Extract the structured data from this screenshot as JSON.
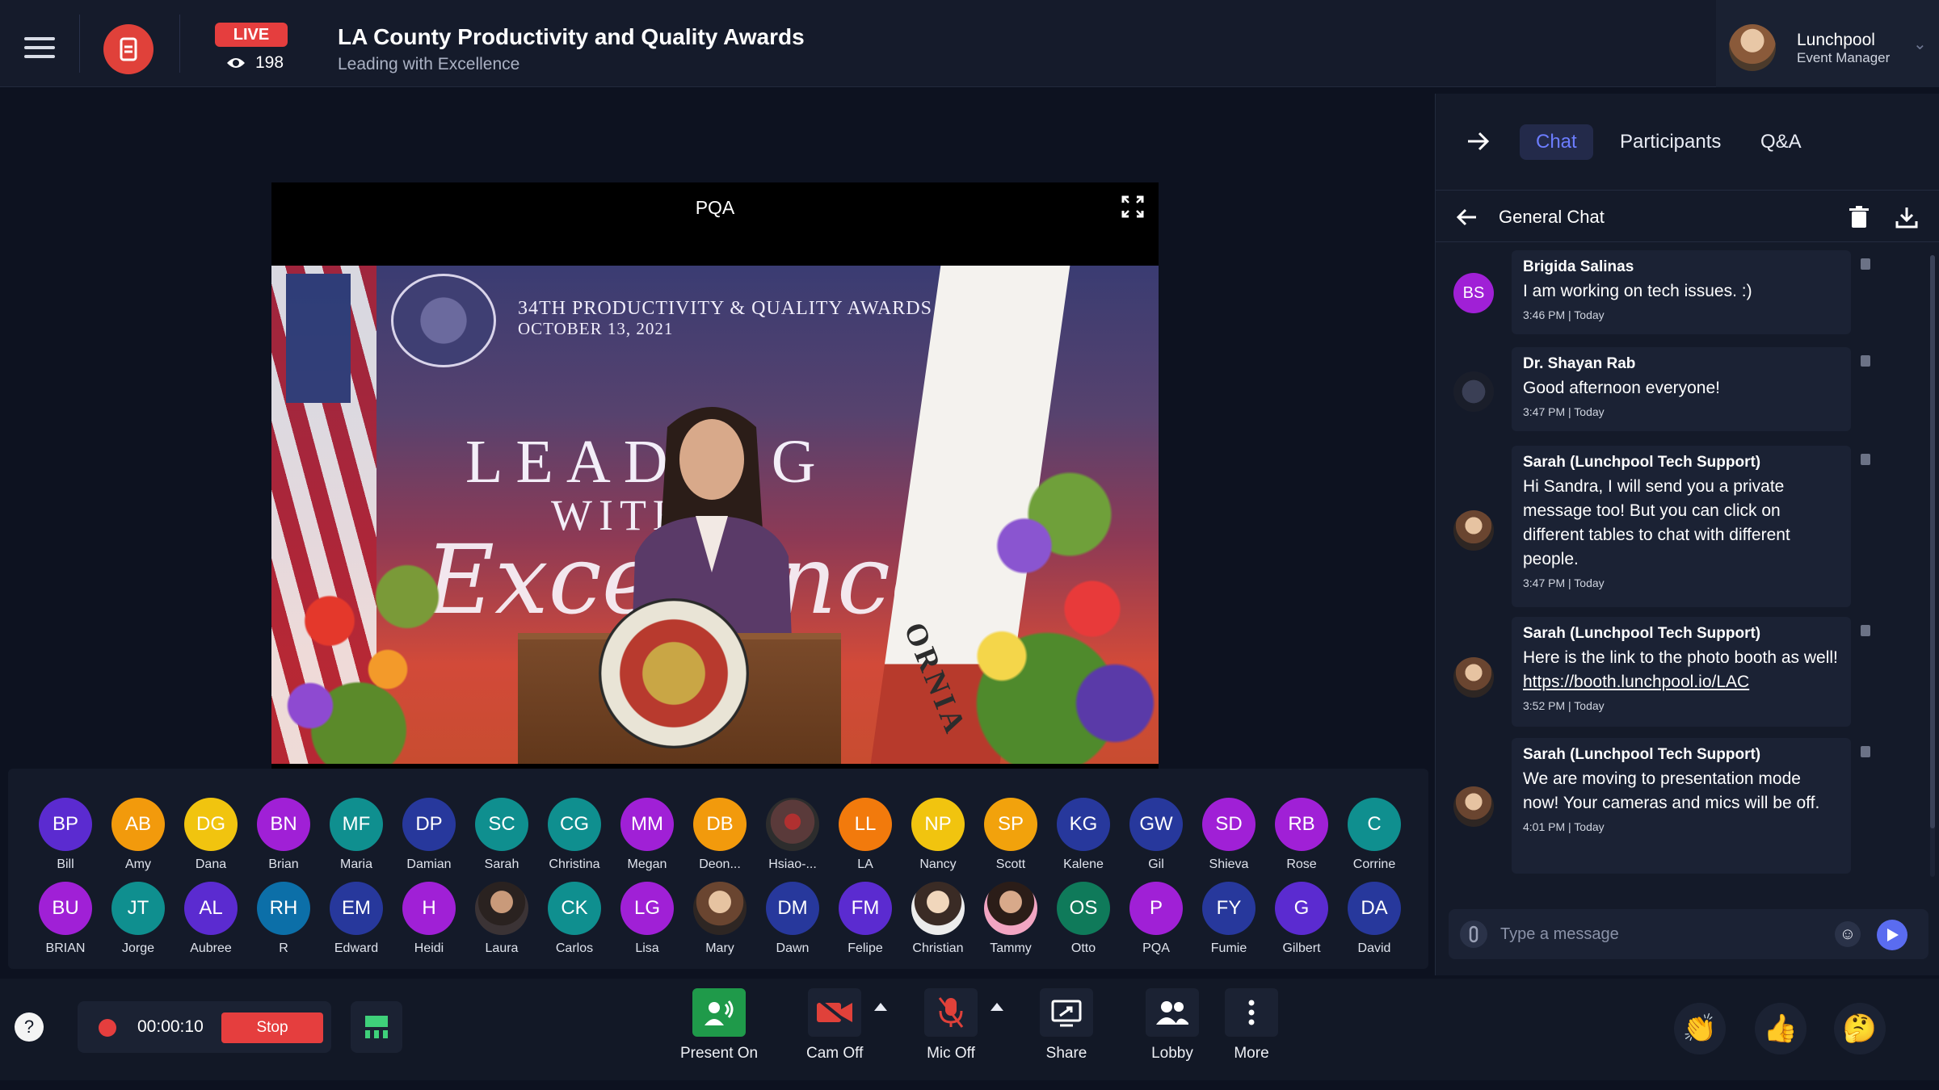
{
  "header": {
    "live_label": "LIVE",
    "viewer_count": "198",
    "title": "LA County Productivity and Quality Awards",
    "subtitle": "Leading with Excellence",
    "user_name": "Lunchpool",
    "user_role": "Event Manager"
  },
  "stage": {
    "video_label": "PQA",
    "banner_line1": "34TH PRODUCTIVITY & QUALITY AWARDS",
    "banner_line2": "OCTOBER 13, 2021",
    "backdrop_lead": "LEADING",
    "backdrop_with": "WITH",
    "backdrop_excellence": "Excellence",
    "backdrop_state": "ORNIA"
  },
  "participants": {
    "row1": [
      {
        "initials": "BP",
        "name": "Bill",
        "color": "#5b2bd0"
      },
      {
        "initials": "AB",
        "name": "Amy",
        "color": "#f29a0c"
      },
      {
        "initials": "DG",
        "name": "Dana",
        "color": "#f1c40f"
      },
      {
        "initials": "BN",
        "name": "Brian",
        "color": "#a020d6"
      },
      {
        "initials": "MF",
        "name": "Maria",
        "color": "#0f8f8f"
      },
      {
        "initials": "DP",
        "name": "Damian",
        "color": "#27389c"
      },
      {
        "initials": "SC",
        "name": "Sarah",
        "color": "#0f8f8f"
      },
      {
        "initials": "CG",
        "name": "Christina",
        "color": "#0f8f8f"
      },
      {
        "initials": "MM",
        "name": "Megan",
        "color": "#a020d6"
      },
      {
        "initials": "DB",
        "name": "Deon...",
        "color": "#f29a0c"
      },
      {
        "initials": "",
        "name": "Hsiao-...",
        "color": "#4a3030"
      },
      {
        "initials": "LL",
        "name": "LA",
        "color": "#f27a0c"
      },
      {
        "initials": "NP",
        "name": "Nancy",
        "color": "#f1c40f"
      },
      {
        "initials": "SP",
        "name": "Scott",
        "color": "#f2a20c"
      },
      {
        "initials": "KG",
        "name": "Kalene",
        "color": "#27389c"
      },
      {
        "initials": "GW",
        "name": "Gil",
        "color": "#27389c"
      },
      {
        "initials": "SD",
        "name": "Shieva",
        "color": "#a020d6"
      },
      {
        "initials": "RB",
        "name": "Rose",
        "color": "#a020d6"
      },
      {
        "initials": "C",
        "name": "Corrine",
        "color": "#0f8f8f"
      }
    ],
    "row2": [
      {
        "initials": "BU",
        "name": "BRIAN",
        "color": "#a020d6"
      },
      {
        "initials": "JT",
        "name": "Jorge",
        "color": "#0f8f8f"
      },
      {
        "initials": "AL",
        "name": "Aubree",
        "color": "#5b2bd0"
      },
      {
        "initials": "RH",
        "name": "R",
        "color": "#0c6fa8"
      },
      {
        "initials": "EM",
        "name": "Edward",
        "color": "#27389c"
      },
      {
        "initials": "H",
        "name": "Heidi",
        "color": "#a020d6"
      },
      {
        "initials": "",
        "name": "Laura",
        "color": "#2d2d2d"
      },
      {
        "initials": "CK",
        "name": "Carlos",
        "color": "#0f8f8f"
      },
      {
        "initials": "LG",
        "name": "Lisa",
        "color": "#a020d6"
      },
      {
        "initials": "",
        "name": "Mary",
        "color": "#6a4530"
      },
      {
        "initials": "DM",
        "name": "Dawn",
        "color": "#27389c"
      },
      {
        "initials": "FM",
        "name": "Felipe",
        "color": "#5b2bd0"
      },
      {
        "initials": "",
        "name": "Christian",
        "color": "#ececec"
      },
      {
        "initials": "",
        "name": "Tammy",
        "color": "#f2a5c2"
      },
      {
        "initials": "OS",
        "name": "Otto",
        "color": "#0f7a5a"
      },
      {
        "initials": "P",
        "name": "PQA",
        "color": "#a020d6"
      },
      {
        "initials": "FY",
        "name": "Fumie",
        "color": "#27389c"
      },
      {
        "initials": "G",
        "name": "Gilbert",
        "color": "#5b2bd0"
      },
      {
        "initials": "DA",
        "name": "David",
        "color": "#27389c"
      }
    ]
  },
  "controls": {
    "recording_time": "00:00:10",
    "stop_label": "Stop",
    "present_label": "Present On",
    "cam_label": "Cam Off",
    "mic_label": "Mic Off",
    "share_label": "Share",
    "lobby_label": "Lobby",
    "more_label": "More"
  },
  "chat": {
    "tabs": [
      "Chat",
      "Participants",
      "Q&A"
    ],
    "active_tab": "Chat",
    "room_title": "General Chat",
    "composer_placeholder": "Type a message",
    "messages": [
      {
        "sender": "Brigida Salinas",
        "initials": "BS",
        "text": "I am working on tech issues. :)",
        "time": "3:46 PM | Today"
      },
      {
        "sender": "Dr. Shayan Rab",
        "initials": "",
        "text": "Good afternoon everyone!",
        "time": "3:47 PM | Today"
      },
      {
        "sender": "Sarah (Lunchpool Tech Support)",
        "initials": "",
        "text": "Hi Sandra, I will send you a private message too! But you can click on different tables to chat with different people.",
        "time": "3:47 PM | Today"
      },
      {
        "sender": "Sarah (Lunchpool Tech Support)",
        "initials": "",
        "text_before_link": "Here is the link to the photo booth as well! ",
        "link": "https://booth.lunchpool.io/LAC",
        "time": "3:52 PM | Today"
      },
      {
        "sender": "Sarah (Lunchpool Tech Support)",
        "initials": "",
        "text": "We are moving to presentation mode now! Your cameras and mics will be off.",
        "time": "4:01 PM | Today"
      }
    ]
  },
  "colors": {
    "accent": "#6c7dff",
    "live_red": "#e53e3e",
    "present_green": "#1f9a4a",
    "off_red": "#e0413a"
  }
}
